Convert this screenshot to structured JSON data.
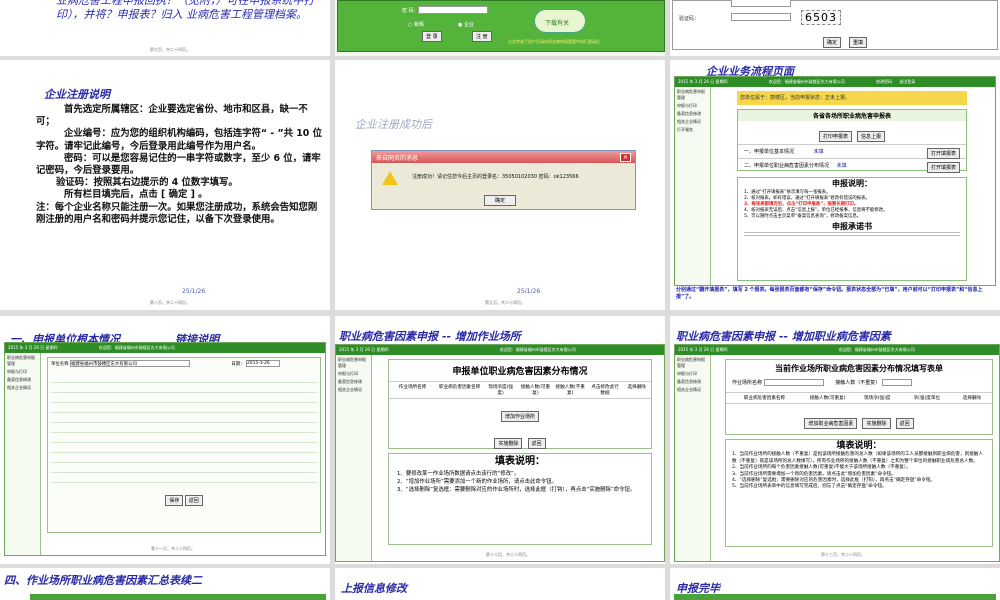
{
  "top_left": {
    "text": "业病危害工程申报回执？（见附，）可在申报系统中打印），并将？申报表？归入 业病危害工程管理档案。",
    "footer": "第七页，共二十四页。"
  },
  "top_middle": {
    "password_label": "密 码：",
    "radio_new": "新辉",
    "radio_enterprise": "企业",
    "login_button": "登 录",
    "register_button": "注 册",
    "logo_text": "下载有关",
    "notice": "企业完成了用户后请在职业病申报管理中进行登录后"
  },
  "top_right": {
    "code_label": "验证码：",
    "captcha": "6503",
    "confirm_button": "确定",
    "reset_button": "重填"
  },
  "enterprise_register": {
    "title": "企业注册说明",
    "p1": "首先选定所属辖区：企业要选定省份、地市和区县，缺一不可；",
    "p2": "企业编号：应为您的组织机构编码，包括连字符“ - ”共 10 位字符。请牢记此编号，今后登录用此编号作为用户名。",
    "p3": "密码：可以是您容易记住的一串字符或数字，至少 6 位，请牢记密码，今后登录要用。",
    "p4": "验证码：按照其右边提示的 4 位数字填写。",
    "p5": "所有栏目填完后，点击 [ 确定 ] 。",
    "p6": "注：每个企业名称只能注册一次。如果您注册成功，系统会告知您刚刚注册的用户名和密码并提示您记住，以备下次登录使用。",
    "page": "25/1/26",
    "footer": "第八页，共二十四页。"
  },
  "register_success": {
    "title": "企业注册成功后",
    "dialog_title": "来自网页的消息",
    "message": "注册成功！请记住您今后主页的登录名：35050102030   密码：ok123566",
    "ok_button": "确定",
    "page": "25/1/26",
    "footer": "第九页，共二十四页。"
  },
  "business_flow": {
    "title": "企业业务流程页面",
    "topbar_left": "2015 年 3 月 26 日 星期四",
    "topbar_mid": "欢迎您：福建省福州市鼓楼区东大有限公司",
    "topbar_right1": "修改密码",
    "topbar_right2": "退出登录",
    "sidebar": [
      "职业病危害申报管理",
      "申报与打印",
      "备案信息修改",
      "相关企业情况",
      "打开服务"
    ],
    "welcome": "您单位属于：鼓楼区，当前申报状态：正未上报。",
    "table_header": "各省各场所职业病危害申报表",
    "btn_print": "打印申报表",
    "btn_submit": "信息上报",
    "row1": "一、申报单位基本情况",
    "row1_status": "未填",
    "row2": "二、申报单位职业病危害因素分布情况",
    "row2_status": "未填",
    "btn_open": "打开填报表",
    "notice_title": "申报说明：",
    "notes": [
      "1、通过“打开填报表”依次填写每一张报表。",
      "2、核对报表。如有错误，通过“打开填报表”修改有错误的报表。",
      "3、每张表都填完后，点击“打印申报表”，报要长期打印。",
      "4、核对报表无误后，点击“信息上报”。单位已经报事，信息将不能修改。",
      "5、可以随时点击主页菜单“备案信息查询”，修改备案信息。"
    ],
    "commit_title": "申报承诺书",
    "caption": "分别通过“翻开填报表”，填写 2 个报表。每张报表页面都有“保存”命令钮。报表状态全部为“已填”，用户就可以“打印申报表”和“信息上报”了。"
  },
  "basic_info": {
    "title": "一、申报单位根本情况",
    "link": "链接说明",
    "topbar_left": "2015 年 3 月 26 日 星期四",
    "topbar_mid": "欢迎您：福建省福州市鼓楼区东大有限公司",
    "unit_label": "单位名称",
    "unit_value": "福建省福州市鼓楼区东大有限公司",
    "date_label": "日期：",
    "date_value": "2015-3-26",
    "confirm_button": "保存",
    "back_button": "返回",
    "footer": "第十一页，共二十四页。"
  },
  "add_site": {
    "title": "职业病危害因素申报 -- 增加作业场所",
    "topbar_left": "2015 年 3 月 26 日 星期四",
    "topbar_mid": "欢迎您：福建省福州市鼓楼区东大有限公司",
    "table_title": "申报单位职业病危害因素分布情况",
    "cols": [
      "作业场所名称",
      "职业病危害因素名称",
      "现场浓度(强度)",
      "接触人数(可重复)",
      "接触人数(不重复)",
      "点击修改此行数据",
      "选择删除"
    ],
    "add_button": "增加作业场所",
    "delete_button": "实施删除",
    "back_button": "返回",
    "notice_title": "填表说明：",
    "notes": [
      "1、要修改某一作业场所数据请点击该行的“修改”。",
      "2、“增加作业场所”需要添加一个新的作业场所，请点击此命令钮。",
      "3、“选择删除”复选框：需要删除对应的作业场所时，选择此框（打钩），再点击“实施删除”命令钮。"
    ],
    "footer": "第十二页，共二十四页。"
  },
  "add_factor": {
    "title": "职业病危害因素申报 -- 增加职业病危害因素",
    "topbar_left": "2015 年 3 月 26 日 星期四",
    "topbar_mid": "欢迎您：福建省福州市鼓楼区东大有限公司",
    "table_title": "当前作业场所职业病危害因素分布情况填写表单",
    "site_label": "作业场所名称",
    "count_label": "接触人数（不重复）",
    "cols": [
      "职业病危害因素名称",
      "接触人数(可重复)",
      "现场浓(强)度",
      "浓(强)度单位",
      "选择删除"
    ],
    "add_button": "增加职业病危害因素",
    "delete_button": "实施删除",
    "back_button": "返回",
    "notice_title": "填表说明：",
    "notes": [
      "1、当前作业场所的接触人数（不重复）是指该场所接触危害的总人数（如果该场所的工人员都接触到职业病危害，则接触人数（不重复）就是该场所的总人数填写），所有作业场所的接触人数（不重复）之和为整个单位的接触职业病危害总人数。",
      "2、当前作业场所的每个危害因素接触人数(可重复)不能大于该场所接触人数（不重复）。",
      "3、当前作业场所需要增加一个新的危害因素，请点击此“增加危害因素”命令钮。",
      "4、“选择删除”复选框：需要删除对应的危害因素时，选择此框（打钩），再点击“确定存盘”命令钮。",
      "5、当前作业场所表单中的信息填写完成后，别忘了点击“确定存盘”命令钮。"
    ],
    "footer": "第十三页，共二十四页。"
  },
  "bottom": {
    "summary_title": "四、作业场所职业病危害因素汇总表续二",
    "update_title": "上报信息修改",
    "done_title": "申报完毕"
  }
}
